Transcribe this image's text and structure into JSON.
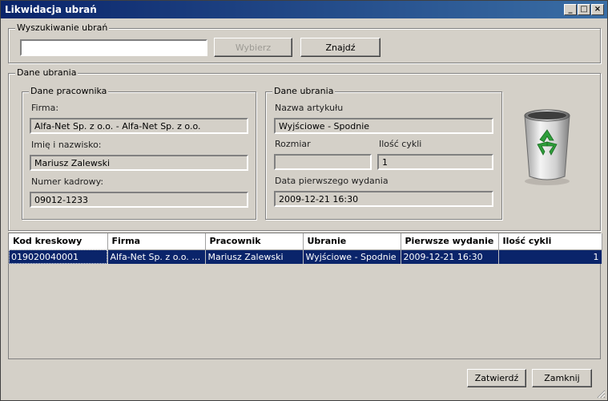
{
  "window": {
    "title": "Likwidacja ubrań",
    "minimize": "_",
    "maximize": "□",
    "close": "×"
  },
  "search": {
    "legend": "Wyszukiwanie ubrań",
    "value": "",
    "choose_label": "Wybierz",
    "find_label": "Znajdź"
  },
  "details": {
    "legend": "Dane ubrania",
    "employee": {
      "legend": "Dane pracownika",
      "company_label": "Firma:",
      "company_value": "Alfa-Net Sp. z o.o.  - Alfa-Net Sp. z o.o.",
      "name_label": "Imię i nazwisko:",
      "name_value": "Mariusz Zalewski",
      "number_label": "Numer kadrowy:",
      "number_value": "09012-1233"
    },
    "clothing": {
      "legend": "Dane ubrania",
      "article_label": "Nazwa artykułu",
      "article_value": "Wyjściowe - Spodnie",
      "size_label": "Rozmiar",
      "size_value": "",
      "cycles_label": "Ilość cykli",
      "cycles_value": "1",
      "first_issue_label": "Data pierwszego wydania",
      "first_issue_value": "2009-12-21 16:30"
    },
    "icon": "recycle-bin-icon"
  },
  "table": {
    "columns": [
      "Kod kreskowy",
      "Firma",
      "Pracownik",
      "Ubranie",
      "Pierwsze wydanie",
      "Ilość cykli"
    ],
    "rows": [
      {
        "barcode": "019020040001",
        "company": "Alfa-Net Sp. z o.o.  - Alfa-Net Sp. z o.o.",
        "employee": "Mariusz Zalewski",
        "clothing": "Wyjściowe - Spodnie",
        "first_issue": "2009-12-21 16:30",
        "cycles": "1"
      }
    ]
  },
  "footer": {
    "confirm_label": "Zatwierdź",
    "close_label": "Zamknij"
  },
  "colors": {
    "title_bar": "#0a246a",
    "selection": "#0a246a",
    "face": "#d4d0c8",
    "recycle_green": "#2e9e3a"
  }
}
